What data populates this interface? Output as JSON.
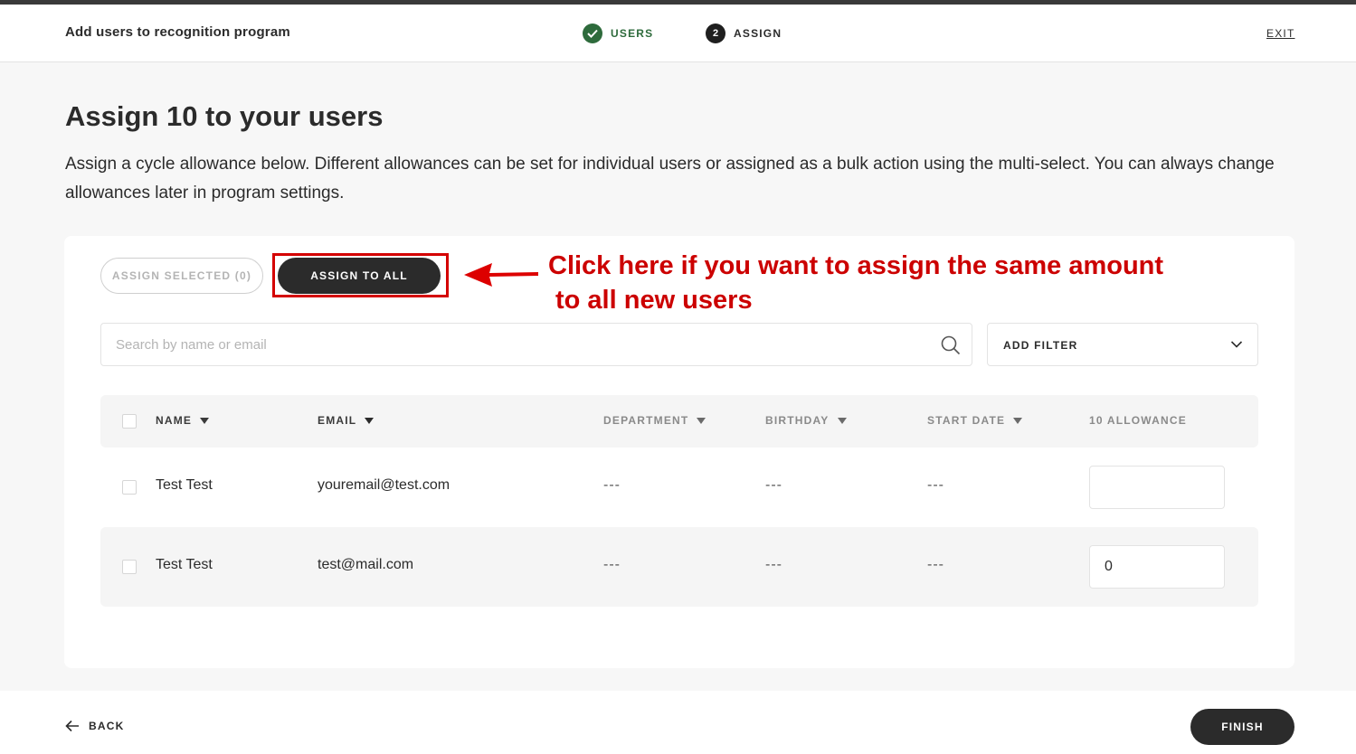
{
  "header": {
    "title": "Add users to recognition program",
    "steps": [
      {
        "number": "✓",
        "label": "USERS",
        "state": "done"
      },
      {
        "number": "2",
        "label": "ASSIGN",
        "state": "current"
      }
    ],
    "exit_label": "EXIT"
  },
  "main": {
    "title": "Assign 10 to your users",
    "description": "Assign a cycle allowance below. Different allowances can be set for individual users or assigned as a bulk action using the multi-select. You can always change allowances later in program settings."
  },
  "actions": {
    "assign_selected_label": "ASSIGN SELECTED (0)",
    "assign_all_label": "ASSIGN TO ALL"
  },
  "annotation": {
    "line1": "Click here if you want to assign the same amount",
    "line2": "to all new users"
  },
  "search": {
    "placeholder": "Search by name or email",
    "value": ""
  },
  "filter": {
    "label": "ADD FILTER"
  },
  "table": {
    "columns": [
      "NAME",
      "EMAIL",
      "DEPARTMENT",
      "BIRTHDAY",
      "START DATE",
      "10 ALLOWANCE"
    ],
    "rows": [
      {
        "name": "Test Test",
        "email": "youremail@test.com",
        "department": "---",
        "birthday": "---",
        "start_date": "---",
        "allowance": ""
      },
      {
        "name": "Test Test",
        "email": "test@mail.com",
        "department": "---",
        "birthday": "---",
        "start_date": "---",
        "allowance": "0"
      }
    ]
  },
  "footer": {
    "back_label": "BACK",
    "finish_label": "FINISH"
  },
  "colors": {
    "accent_dark": "#2b2b2b",
    "step_done": "#2e6b3c",
    "annotation_red": "#cc0000"
  }
}
